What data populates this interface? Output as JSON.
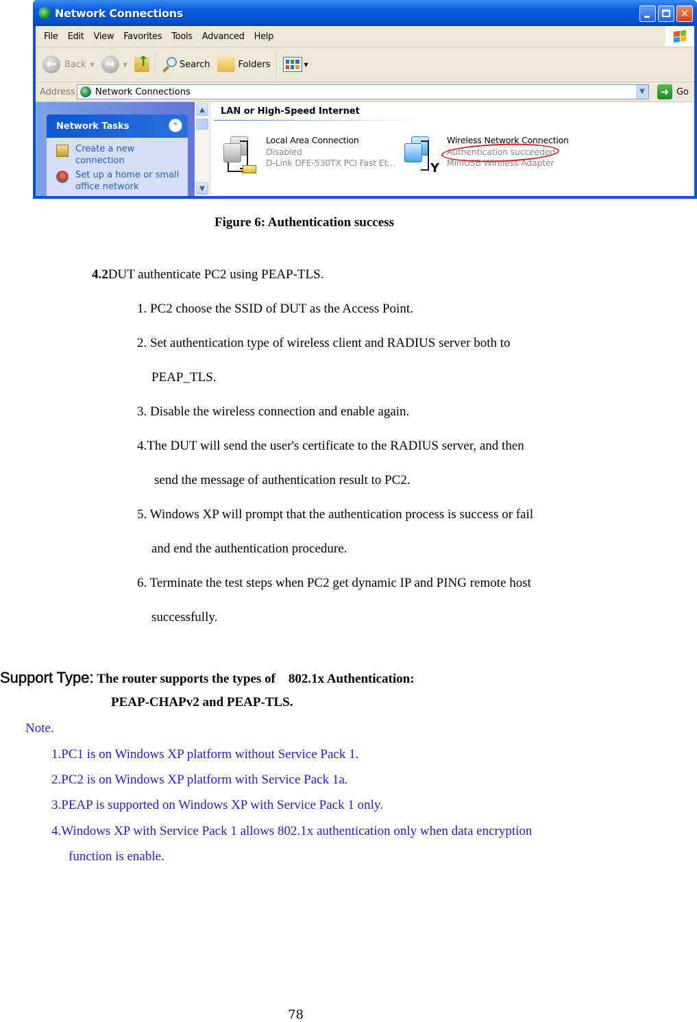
{
  "screenshot": {
    "window": {
      "title": "Network Connections",
      "controls": [
        "minimize",
        "maximize",
        "close"
      ]
    },
    "menu": [
      "File",
      "Edit",
      "View",
      "Favorites",
      "Tools",
      "Advanced",
      "Help"
    ],
    "toolbar": {
      "back_label": "Back",
      "search_label": "Search",
      "folders_label": "Folders"
    },
    "address": {
      "label": "Address",
      "value": "Network Connections",
      "go_label": "Go"
    },
    "task_pane": {
      "title": "Network Tasks",
      "items": [
        {
          "icon": "new-connection-icon",
          "label_line1": "Create a new",
          "label_line2": "connection"
        },
        {
          "icon": "home-network-icon",
          "label_line1": "Set up a home or small",
          "label_line2": "office network"
        }
      ]
    },
    "group_title": "LAN or High-Speed Internet",
    "connections": [
      {
        "name": "Local Area Connection",
        "status": "Disabled",
        "device": "D-Link DFE-530TX PCI Fast Et..."
      },
      {
        "name": "Wireless Network Connection",
        "status": "Authentication succeeded",
        "device": "MiniUSB Wireless Adapter",
        "highlighted": true
      }
    ],
    "colors": {
      "title_bar": "#0453d3",
      "highlight": "#d21e1e",
      "task_link": "#215dc6"
    }
  },
  "figure_caption": "Figure 6: Authentication success",
  "section": {
    "number": "4.2",
    "title": "DUT authenticate PC2 using PEAP-TLS.",
    "steps": [
      "1.  PC2 choose the SSID of DUT as the Access Point.",
      "2.  Set authentication type of wireless client and RADIUS server both to",
      "PEAP_TLS.",
      "3.  Disable the wireless connection and enable again.",
      "4.The DUT will send the user's certificate to the RADIUS server, and then",
      "send the message of authentication result to PC2.",
      "5.  Windows XP will prompt that the authentication process is success or fail",
      "and end the authentication procedure.",
      "6.  Terminate the test steps when PC2 get dynamic IP and PING remote host",
      "successfully."
    ]
  },
  "support_type": {
    "label": "Support Type:",
    "text_line1": "The router supports the types of    802.1x Authentication:",
    "text_line2": "PEAP-CHAPv2 and PEAP-TLS."
  },
  "note": {
    "label": "Note.",
    "items": [
      "1.PC1 is on Windows XP platform without Service Pack 1.",
      "2.PC2 is on Windows XP platform with Service Pack 1a.",
      "3.PEAP is supported on Windows XP with Service Pack 1 only.",
      "4.Windows XP with Service Pack 1 allows 802.1x authentication only when data encryption",
      "function is enable."
    ],
    "color": "#1f1fd6"
  },
  "page_number": "78"
}
